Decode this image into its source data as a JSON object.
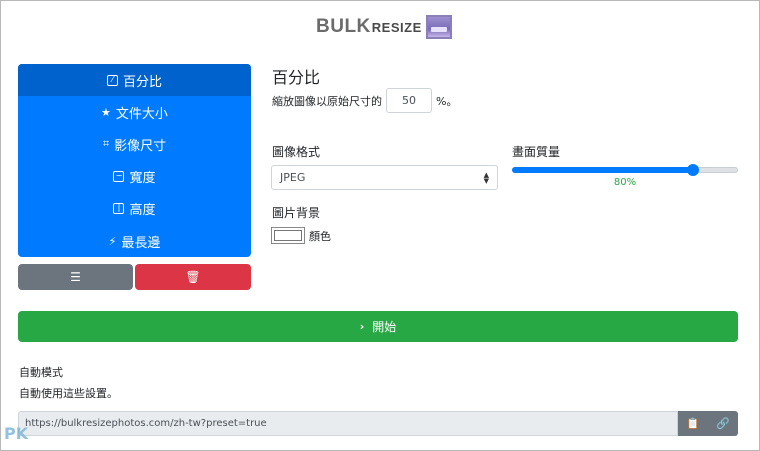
{
  "logo": {
    "bulk": "BULK",
    "resize": "RESIZE"
  },
  "menu": {
    "items": [
      {
        "label": "百分比",
        "icon": "edit-box-icon",
        "glyph": "⁄",
        "active": true
      },
      {
        "label": "文件大小",
        "icon": "star-icon",
        "glyph": "★",
        "active": false
      },
      {
        "label": "影像尺寸",
        "icon": "scan-icon",
        "glyph": "⌗",
        "active": false
      },
      {
        "label": "寬度",
        "icon": "minus-box-icon",
        "glyph": "−",
        "active": false
      },
      {
        "label": "高度",
        "icon": "bar-box-icon",
        "glyph": "|",
        "active": false
      },
      {
        "label": "最長邊",
        "icon": "bolt-icon",
        "glyph": "⚡",
        "active": false
      }
    ]
  },
  "actions": {
    "list_icon": "list-icon",
    "list_glyph": "☰",
    "delete_icon": "trash-icon",
    "delete_glyph": "🗑"
  },
  "percentage": {
    "title": "百分比",
    "prefix": "縮放圖像以原始尺寸的",
    "value": "50",
    "suffix": "%。"
  },
  "format": {
    "label": "圖像格式",
    "selected": "JPEG"
  },
  "quality": {
    "label": "畫面質量",
    "value": 0.8,
    "value_text": "80%"
  },
  "background": {
    "label": "圖片背景",
    "color_label": "顏色",
    "color": "#ffffff"
  },
  "start": {
    "label": "開始",
    "chevron": "›"
  },
  "auto": {
    "title": "自動模式",
    "desc": "自動使用這些設置。",
    "url": "https://bulkresizephotos.com/zh-tw?preset=true"
  },
  "url_buttons": {
    "copy_glyph": "📋",
    "link_glyph": "🔗"
  },
  "watermark": "PK",
  "colors": {
    "primary": "#007bff",
    "primary_active": "#0062cc",
    "success": "#28a745",
    "danger": "#dc3545",
    "secondary": "#6c757d"
  }
}
